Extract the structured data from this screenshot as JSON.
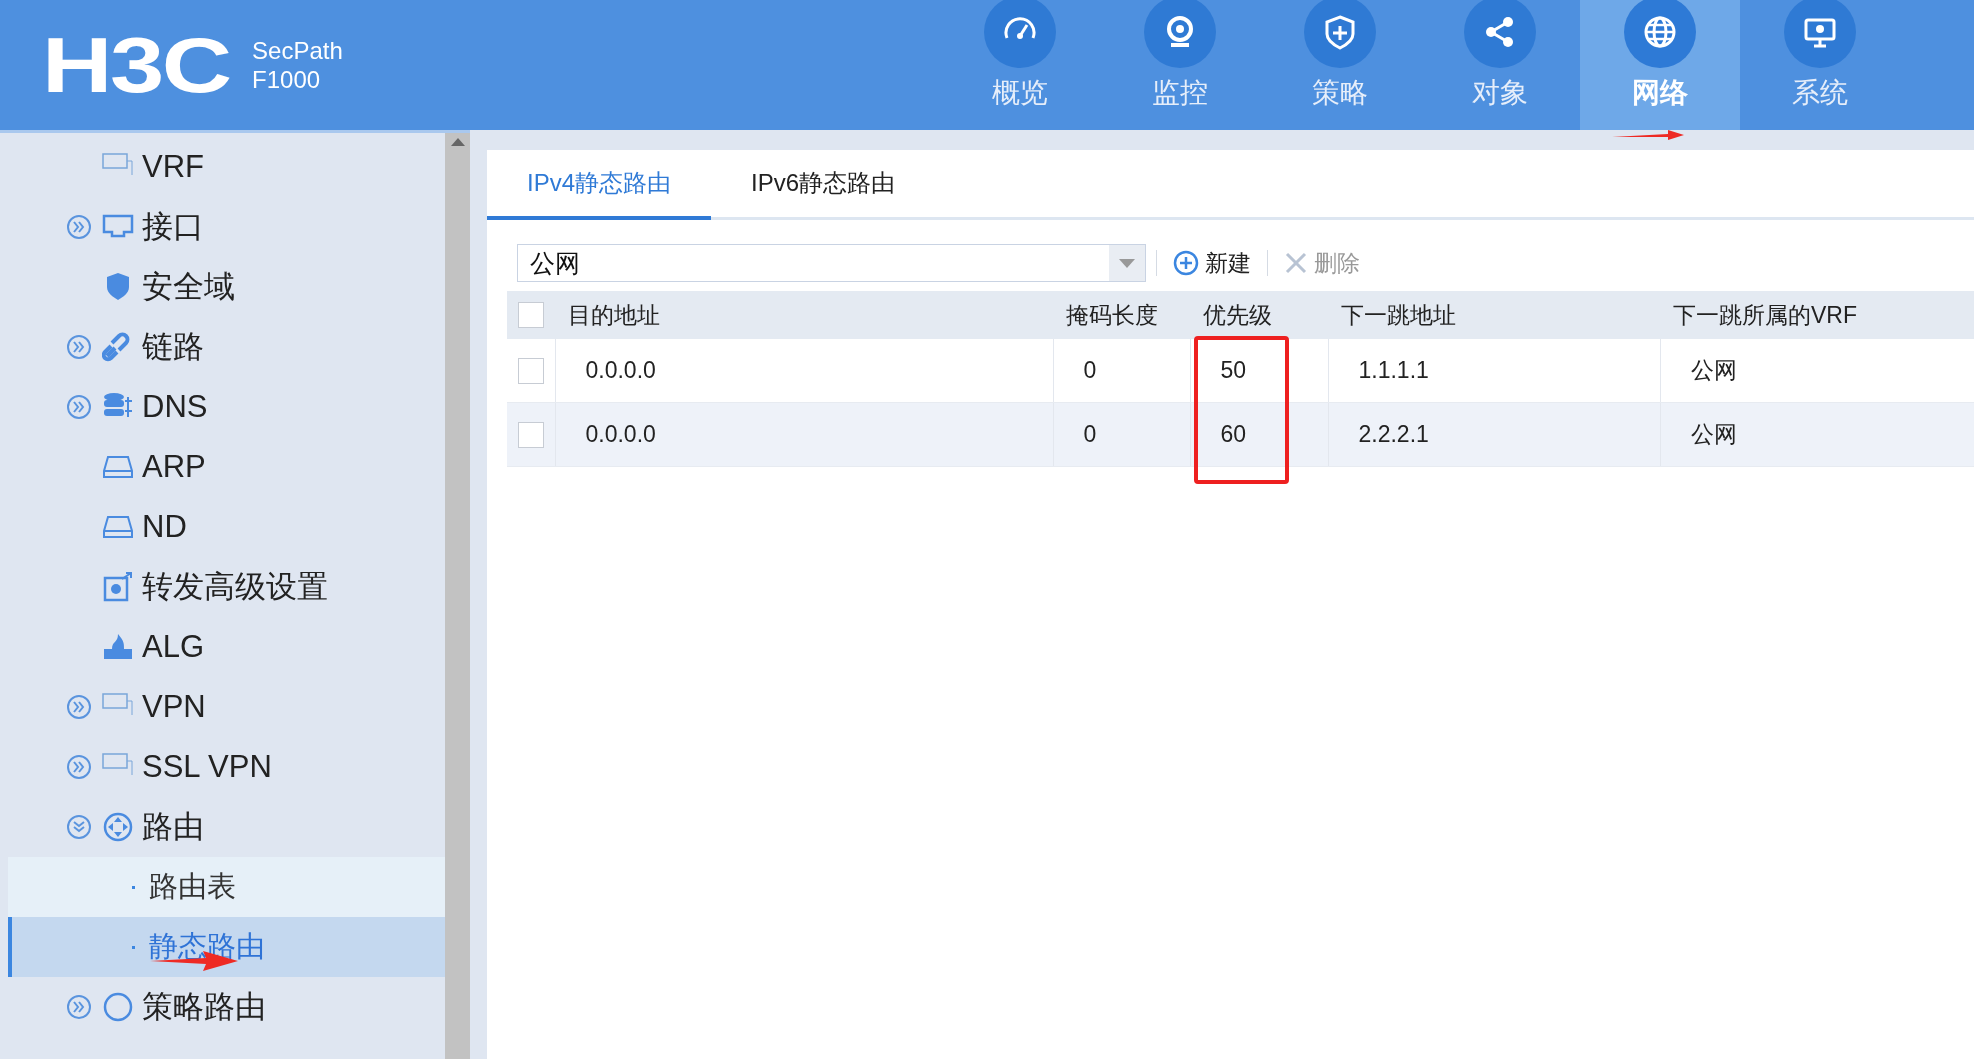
{
  "header": {
    "brand": "H3C",
    "product_line": "SecPath",
    "model": "F1000",
    "nav": [
      {
        "label": "概览",
        "selected": false
      },
      {
        "label": "监控",
        "selected": false
      },
      {
        "label": "策略",
        "selected": false
      },
      {
        "label": "对象",
        "selected": false
      },
      {
        "label": "网络",
        "selected": true
      },
      {
        "label": "系统",
        "selected": false
      }
    ]
  },
  "sidebar": {
    "items": [
      {
        "label": "VRF",
        "expandable": false
      },
      {
        "label": "接口",
        "expandable": true,
        "expanded": false
      },
      {
        "label": "安全域",
        "expandable": false
      },
      {
        "label": "链路",
        "expandable": true,
        "expanded": false
      },
      {
        "label": "DNS",
        "expandable": true,
        "expanded": false
      },
      {
        "label": "ARP",
        "expandable": false
      },
      {
        "label": "ND",
        "expandable": false
      },
      {
        "label": "转发高级设置",
        "expandable": false
      },
      {
        "label": "ALG",
        "expandable": false
      },
      {
        "label": "VPN",
        "expandable": true,
        "expanded": false
      },
      {
        "label": "SSL VPN",
        "expandable": true,
        "expanded": false
      },
      {
        "label": "路由",
        "expandable": true,
        "expanded": true,
        "children": [
          {
            "label": "路由表",
            "selected": false
          },
          {
            "label": "静态路由",
            "selected": true
          }
        ]
      },
      {
        "label": "策略路由",
        "expandable": true,
        "expanded": false
      }
    ]
  },
  "tabs": [
    {
      "label": "IPv4静态路由",
      "selected": true
    },
    {
      "label": "IPv6静态路由",
      "selected": false
    }
  ],
  "toolbar": {
    "vrf_select": "公网",
    "buttons": [
      {
        "label": "新建",
        "disabled": false
      },
      {
        "label": "删除",
        "disabled": true
      }
    ]
  },
  "table": {
    "all_checked": false,
    "columns": [
      "目的地址",
      "掩码长度",
      "优先级",
      "下一跳地址",
      "下一跳所属的VRF"
    ],
    "rows": [
      {
        "checked": false,
        "cells": [
          "0.0.0.0",
          "0",
          "50",
          "1.1.1.1",
          "公网"
        ]
      },
      {
        "checked": false,
        "cells": [
          "0.0.0.0",
          "0",
          "60",
          "2.2.2.1",
          "公网"
        ]
      }
    ]
  }
}
